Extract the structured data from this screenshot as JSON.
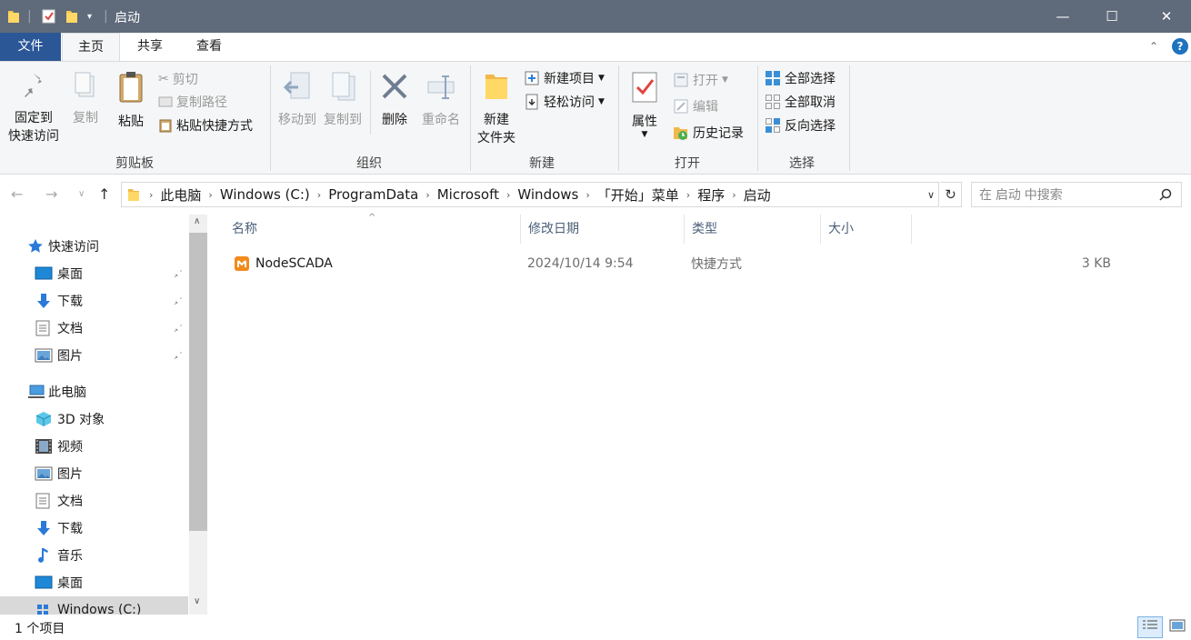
{
  "window": {
    "title": "启动",
    "minimize": "—",
    "maximize": "☐",
    "close": "✕"
  },
  "tabs": [
    "文件",
    "主页",
    "共享",
    "查看"
  ],
  "ribbon": {
    "clipboard": {
      "group_label": "剪贴板",
      "pin_label_1": "固定到",
      "pin_label_2": "快速访问",
      "copy": "复制",
      "paste": "粘贴",
      "cut": "剪切",
      "copy_path": "复制路径",
      "paste_shortcut": "粘贴快捷方式"
    },
    "organize": {
      "group_label": "组织",
      "move_to": "移动到",
      "copy_to": "复制到",
      "delete": "删除",
      "rename": "重命名"
    },
    "new": {
      "group_label": "新建",
      "new_folder_1": "新建",
      "new_folder_2": "文件夹",
      "new_item": "新建项目",
      "easy_access": "轻松访问"
    },
    "open": {
      "group_label": "打开",
      "properties": "属性",
      "open": "打开",
      "edit": "编辑",
      "history": "历史记录"
    },
    "select": {
      "group_label": "选择",
      "select_all": "全部选择",
      "select_none": "全部取消",
      "invert": "反向选择"
    }
  },
  "address": {
    "crumbs": [
      "此电脑",
      "Windows (C:)",
      "ProgramData",
      "Microsoft",
      "Windows",
      "「开始」菜单",
      "程序",
      "启动"
    ],
    "search_placeholder": "在 启动 中搜索"
  },
  "nav": {
    "quick_access": "快速访问",
    "quick_items": [
      "桌面",
      "下载",
      "文档",
      "图片"
    ],
    "this_pc": "此电脑",
    "pc_items": [
      "3D 对象",
      "视频",
      "图片",
      "文档",
      "下载",
      "音乐",
      "桌面",
      "Windows (C:)"
    ]
  },
  "columns": {
    "name": "名称",
    "modified": "修改日期",
    "type": "类型",
    "size": "大小"
  },
  "files": [
    {
      "name": "NodeSCADA",
      "modified": "2024/10/14 9:54",
      "type": "快捷方式",
      "size": "3 KB"
    }
  ],
  "status": {
    "count": "1 个项目"
  },
  "colors": {
    "titlebar": "#5f6b7a",
    "file_tab": "#2b5797",
    "ribbon_bg": "#f5f6f7",
    "accent": "#0078d7"
  }
}
